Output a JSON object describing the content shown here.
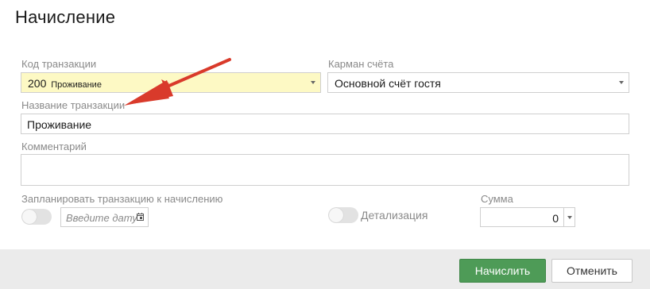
{
  "dialog": {
    "title": "Начисление"
  },
  "form": {
    "transaction_code": {
      "label": "Код транзакции",
      "code": "200",
      "name": "Проживание"
    },
    "account_pocket": {
      "label": "Карман счёта",
      "value": "Основной счёт гостя"
    },
    "transaction_name": {
      "label": "Название транзакции",
      "value": "Проживание"
    },
    "comment": {
      "label": "Комментарий",
      "value": ""
    },
    "schedule": {
      "label": "Запланировать транзакцию к начислению",
      "toggle_on": false,
      "date_placeholder": "Введите дату"
    },
    "detail": {
      "label": "Детализация",
      "toggle_on": false
    },
    "sum": {
      "label": "Сумма",
      "value": "0"
    }
  },
  "footer": {
    "submit_label": "Начислить",
    "cancel_label": "Отменить"
  },
  "colors": {
    "code_field_bg": "#fdf9c4",
    "primary_button": "#4e9b57",
    "annotation_arrow": "#d93a2b",
    "footer_bg": "#ebebeb"
  },
  "icons": {
    "dropdown": "chevron-down-icon",
    "date": "calendar-icon",
    "annotation": "red-arrow-icon"
  }
}
